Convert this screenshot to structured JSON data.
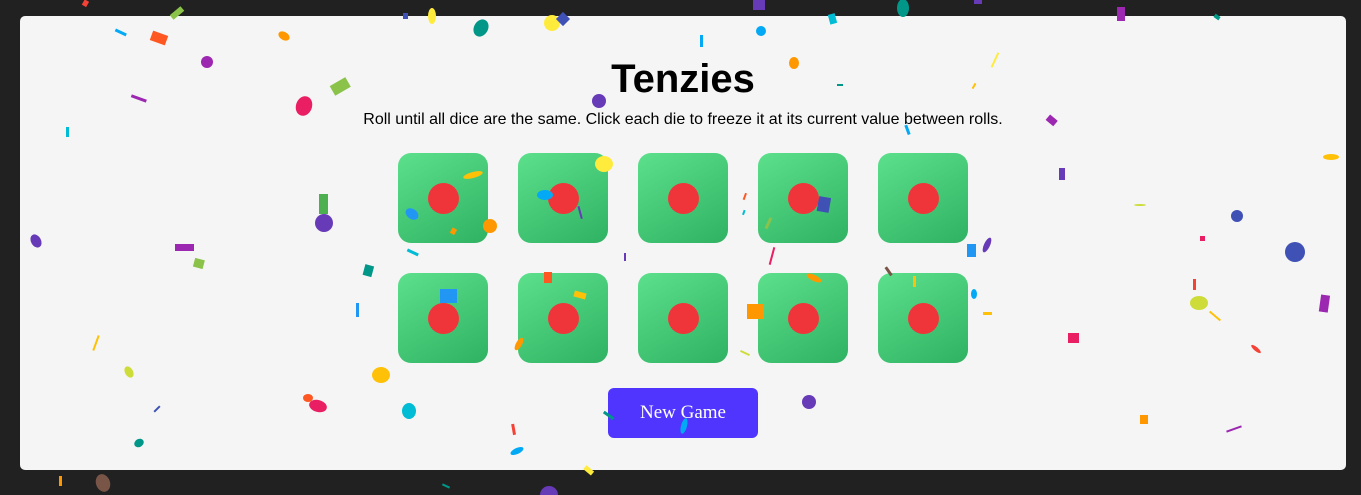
{
  "game": {
    "title": "Tenzies",
    "instructions": "Roll until all dice are the same. Click each die to freeze it at its current value between rolls.",
    "new_game_label": "New Game",
    "won": true
  },
  "dice": [
    {
      "value": 1,
      "held": true
    },
    {
      "value": 1,
      "held": true
    },
    {
      "value": 1,
      "held": true
    },
    {
      "value": 1,
      "held": true
    },
    {
      "value": 1,
      "held": true
    },
    {
      "value": 1,
      "held": true
    },
    {
      "value": 1,
      "held": true
    },
    {
      "value": 1,
      "held": true
    },
    {
      "value": 1,
      "held": true
    },
    {
      "value": 1,
      "held": true
    }
  ],
  "colors": {
    "page_background": "#212121",
    "panel_background": "#f5f5f5",
    "die_green": "#3fc874",
    "pip_red": "#f0353a",
    "button_purple": "#5035ff",
    "confetti": [
      "#e91e63",
      "#9c27b0",
      "#673ab7",
      "#3f51b5",
      "#03a9f4",
      "#00bcd4",
      "#009688",
      "#4caf50",
      "#8bc34a",
      "#cddc39",
      "#ffeb3b",
      "#ffc107",
      "#ff9800",
      "#ff5722",
      "#795548",
      "#2196f3",
      "#f44336"
    ]
  }
}
